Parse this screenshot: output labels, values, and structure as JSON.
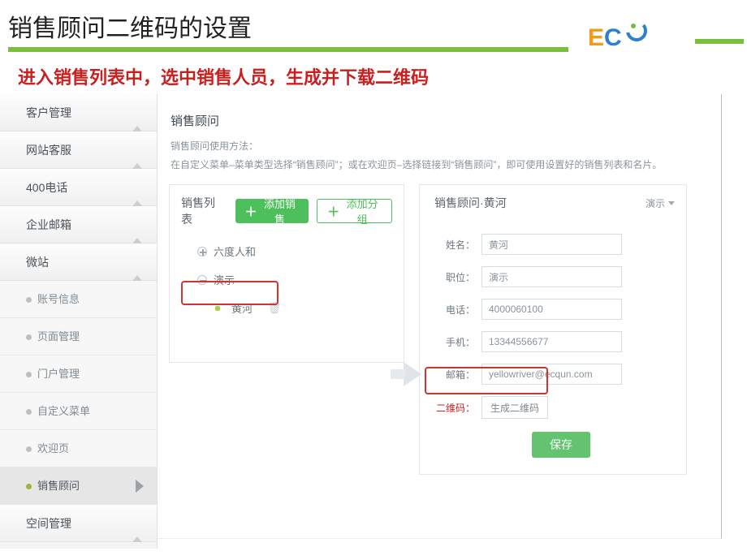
{
  "header": {
    "title": "销售顾问二维码的设置",
    "subtitle": "进入销售列表中，选中销售人员，生成并下载二维码"
  },
  "logo": {
    "brand_text": "EC",
    "accent": "#f39a1e",
    "blue": "#2f7fd1",
    "green": "#7ab83d"
  },
  "sidebar": {
    "groups": [
      {
        "label": "客户管理"
      },
      {
        "label": "网站客服"
      },
      {
        "label": "400电话"
      },
      {
        "label": "企业邮箱"
      },
      {
        "label": "微站"
      }
    ],
    "micro_items": [
      {
        "label": "账号信息"
      },
      {
        "label": "页面管理"
      },
      {
        "label": "门户管理"
      },
      {
        "label": "自定义菜单"
      },
      {
        "label": "欢迎页"
      },
      {
        "label": "销售顾问",
        "active": true
      }
    ],
    "groups_after": [
      {
        "label": "空间管理"
      }
    ]
  },
  "content": {
    "section_title": "销售顾问",
    "hint_label": "销售顾问使用方法：",
    "hint_body": "在自定义菜单–菜单类型选择“销售顾问”；或在欢迎页–选择链接到“销售顾问”，即可使用设置好的销售列表和名片。",
    "list": {
      "title": "销售列表",
      "add_sale_label": "添加销售",
      "add_group_label": "添加分组",
      "nodes": [
        {
          "kind": "plus",
          "label": "六度人和"
        },
        {
          "kind": "minus",
          "label": "演示"
        },
        {
          "kind": "leaf",
          "label": "黄河"
        }
      ]
    },
    "detail": {
      "title": "销售顾问·黄河",
      "dropdown_label": "演示",
      "fields": {
        "name": {
          "label": "姓名：",
          "value": "黄河"
        },
        "title": {
          "label": "职位：",
          "value": "演示"
        },
        "phone": {
          "label": "电话：",
          "value": "4000060100"
        },
        "mobile": {
          "label": "手机：",
          "value": "13344556677"
        },
        "email": {
          "label": "邮箱：",
          "value": "yellowriver@ecqun.com"
        },
        "qr": {
          "label": "二维码：",
          "button": "生成二维码"
        }
      },
      "save_label": "保存"
    }
  }
}
